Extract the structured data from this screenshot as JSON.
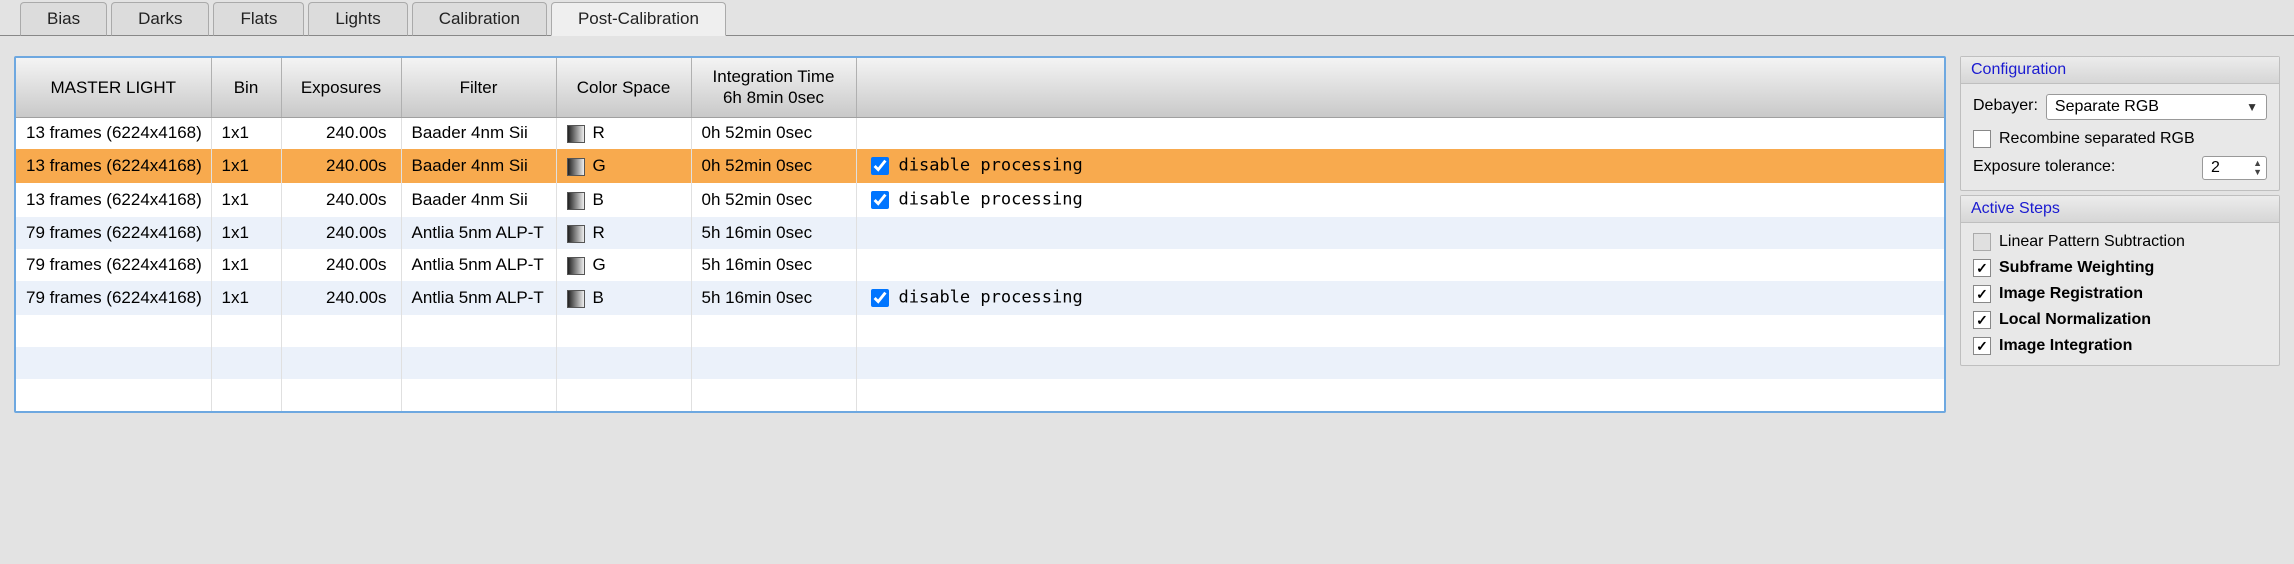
{
  "tabs": [
    {
      "label": "Bias",
      "active": false
    },
    {
      "label": "Darks",
      "active": false
    },
    {
      "label": "Flats",
      "active": false
    },
    {
      "label": "Lights",
      "active": false
    },
    {
      "label": "Calibration",
      "active": false
    },
    {
      "label": "Post-Calibration",
      "active": true
    }
  ],
  "table": {
    "headers": {
      "master": "MASTER LIGHT",
      "bin": "Bin",
      "exposures": "Exposures",
      "filter": "Filter",
      "cspace": "Color Space",
      "integration": "Integration Time\n6h  8min  0sec"
    },
    "rows": [
      {
        "frames": "13 frames (6224x4168)",
        "bin": "1x1",
        "exposure": "240.00s",
        "filter": "Baader 4nm Sii",
        "channel": "R",
        "integration": "0h 52min  0sec",
        "disable_checked": false,
        "disable_shown": false,
        "selected": false,
        "stripe": "a"
      },
      {
        "frames": "13 frames (6224x4168)",
        "bin": "1x1",
        "exposure": "240.00s",
        "filter": "Baader 4nm Sii",
        "channel": "G",
        "integration": "0h 52min  0sec",
        "disable_checked": true,
        "disable_shown": true,
        "selected": true,
        "stripe": "a"
      },
      {
        "frames": "13 frames (6224x4168)",
        "bin": "1x1",
        "exposure": "240.00s",
        "filter": "Baader 4nm Sii",
        "channel": "B",
        "integration": "0h 52min  0sec",
        "disable_checked": true,
        "disable_shown": true,
        "selected": false,
        "stripe": "a"
      },
      {
        "frames": "79 frames (6224x4168)",
        "bin": "1x1",
        "exposure": "240.00s",
        "filter": "Antlia 5nm ALP-T",
        "channel": "R",
        "integration": "5h 16min  0sec",
        "disable_checked": false,
        "disable_shown": false,
        "selected": false,
        "stripe": "b"
      },
      {
        "frames": "79 frames (6224x4168)",
        "bin": "1x1",
        "exposure": "240.00s",
        "filter": "Antlia 5nm ALP-T",
        "channel": "G",
        "integration": "5h 16min  0sec",
        "disable_checked": false,
        "disable_shown": false,
        "selected": false,
        "stripe": "a"
      },
      {
        "frames": "79 frames (6224x4168)",
        "bin": "1x1",
        "exposure": "240.00s",
        "filter": "Antlia 5nm ALP-T",
        "channel": "B",
        "integration": "5h 16min  0sec",
        "disable_checked": true,
        "disable_shown": true,
        "selected": false,
        "stripe": "b"
      }
    ],
    "disable_label": "disable processing",
    "empty_rows": [
      {
        "stripe": "a"
      },
      {
        "stripe": "b"
      },
      {
        "stripe": "a"
      }
    ]
  },
  "config_panel": {
    "title": "Configuration",
    "debayer_label": "Debayer:",
    "debayer_value": "Separate RGB",
    "recombine_label": "Recombine separated RGB",
    "recombine_checked": false,
    "exposure_tol_label": "Exposure tolerance:",
    "exposure_tol_value": "2"
  },
  "steps_panel": {
    "title": "Active  Steps",
    "items": [
      {
        "label": "Linear Pattern Subtraction",
        "checked": false,
        "bold": false,
        "enabled": false
      },
      {
        "label": "Subframe Weighting",
        "checked": true,
        "bold": true,
        "enabled": true
      },
      {
        "label": "Image Registration",
        "checked": true,
        "bold": true,
        "enabled": true
      },
      {
        "label": "Local Normalization",
        "checked": true,
        "bold": true,
        "enabled": true
      },
      {
        "label": "Image Integration",
        "checked": true,
        "bold": true,
        "enabled": true
      }
    ]
  }
}
